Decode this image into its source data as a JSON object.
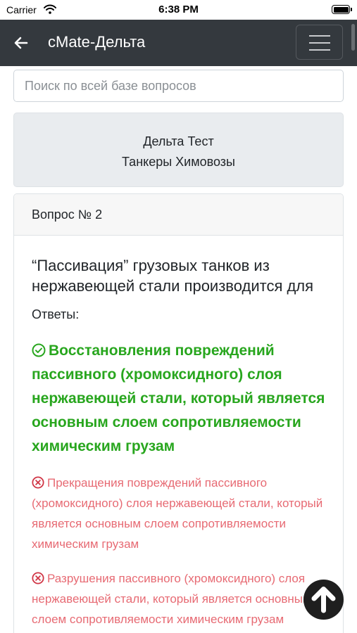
{
  "status_bar": {
    "carrier": "Carrier",
    "time": "6:38 PM"
  },
  "navbar": {
    "title": "cMate-Дельта"
  },
  "search": {
    "placeholder": "Поиск по всей базе вопросов"
  },
  "info": {
    "line1": "Дельта Тест",
    "line2": "Танкеры Химовозы"
  },
  "question_card": {
    "header": "Вопрос № 2",
    "question": "“Пассивация” грузовых танков из нержавеющей стали производится для",
    "answers_label": "Ответы:",
    "answers": [
      {
        "correct": true,
        "text": "Восстановления повреждений пассивного (хромоксидного) слоя нержавеющей стали, который является основным слоем сопротивляемости химическим грузам"
      },
      {
        "correct": false,
        "text": "Прекращения повреждений пассивного (хромоксидного) слоя нержавеющей стали, который является основным слоем сопротивляемости химическим грузам"
      },
      {
        "correct": false,
        "text": "Разрушения пассивного (хромоксидного) слоя нержавеющей стали, который является основным слоем сопротивляемости химическим грузам"
      }
    ]
  },
  "colors": {
    "navbar": "#34393e",
    "correct": "#28a61e",
    "wrong": "#e76a73"
  }
}
